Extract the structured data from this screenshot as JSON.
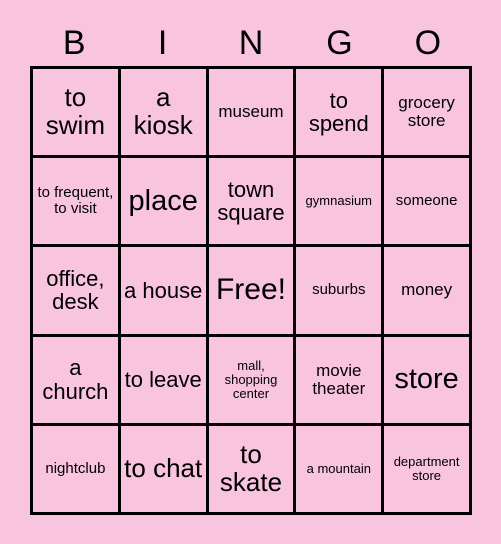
{
  "card": {
    "background_color": "#f9c5de",
    "border_color": "#000000",
    "text_color": "#000000",
    "header_letters": [
      "B",
      "I",
      "N",
      "G",
      "O"
    ],
    "rows": 5,
    "columns": 5,
    "free_space_label": "Free!",
    "free_space_position": {
      "row": 3,
      "column": 3
    },
    "cells": [
      [
        {
          "text": "to swim",
          "size": "lg"
        },
        {
          "text": "a kiosk",
          "size": "lg"
        },
        {
          "text": "museum",
          "size": "sm"
        },
        {
          "text": "to spend",
          "size": "md"
        },
        {
          "text": "grocery store",
          "size": "sm"
        }
      ],
      [
        {
          "text": "to frequent, to visit",
          "size": "xs"
        },
        {
          "text": "place",
          "size": "xl"
        },
        {
          "text": "town square",
          "size": "md"
        },
        {
          "text": "gymnasium",
          "size": "xxs"
        },
        {
          "text": "someone",
          "size": "xs"
        }
      ],
      [
        {
          "text": "office, desk",
          "size": "md"
        },
        {
          "text": "a house",
          "size": "md"
        },
        {
          "text": "Free!",
          "size": "xxl"
        },
        {
          "text": "suburbs",
          "size": "xs"
        },
        {
          "text": "money",
          "size": "sm"
        }
      ],
      [
        {
          "text": "a church",
          "size": "md"
        },
        {
          "text": "to leave",
          "size": "md"
        },
        {
          "text": "mall, shopping center",
          "size": "xxs"
        },
        {
          "text": "movie theater",
          "size": "sm"
        },
        {
          "text": "store",
          "size": "xl"
        }
      ],
      [
        {
          "text": "nightclub",
          "size": "xs"
        },
        {
          "text": "to chat",
          "size": "lg"
        },
        {
          "text": "to skate",
          "size": "lg"
        },
        {
          "text": "a mountain",
          "size": "xxs"
        },
        {
          "text": "department store",
          "size": "xxs"
        }
      ]
    ]
  }
}
